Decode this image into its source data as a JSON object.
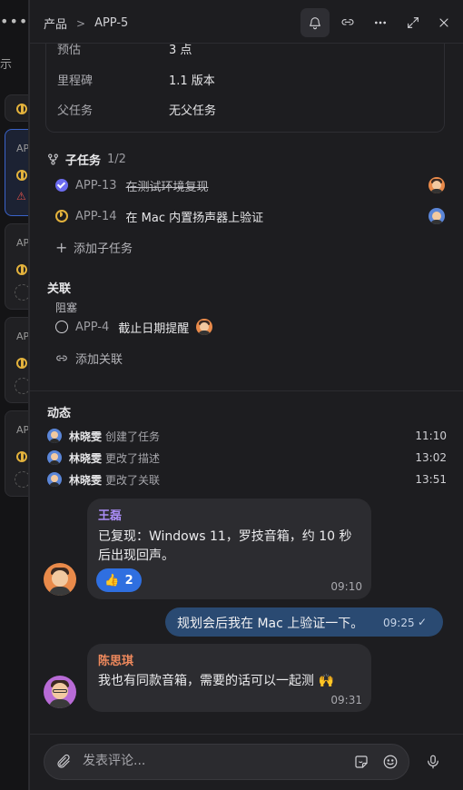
{
  "breadcrumb": {
    "project": "产品",
    "separator": ">",
    "issue": "APP-5"
  },
  "properties": {
    "rows": [
      {
        "label": "预估",
        "value": "3 点"
      },
      {
        "label": "里程碑",
        "value": "1.1 版本"
      },
      {
        "label": "父任务",
        "value": "无父任务"
      }
    ]
  },
  "subtasks": {
    "title": "子任务",
    "count": "1/2",
    "items": [
      {
        "key": "APP-13",
        "title": "在测试环境复现",
        "status": "done"
      },
      {
        "key": "APP-14",
        "title": "在 Mac 内置扬声器上验证",
        "status": "in-progress"
      }
    ],
    "add_label": "添加子任务"
  },
  "relations": {
    "title": "关联",
    "group_label": "阻塞",
    "items": [
      {
        "key": "APP-4",
        "title": "截止日期提醒",
        "status": "todo"
      }
    ],
    "add_label": "添加关联"
  },
  "activity": {
    "title": "动态",
    "items": [
      {
        "user": "林晓雯",
        "action": "创建了任务",
        "time": "11:10"
      },
      {
        "user": "林晓雯",
        "action": "更改了描述",
        "time": "13:02"
      },
      {
        "user": "林晓雯",
        "action": "更改了关联",
        "time": "13:51"
      }
    ]
  },
  "comments": [
    {
      "author": "王磊",
      "author_color": "#a98cf5",
      "lines": [
        "已复现：Windows 11，罗技音箱，约 10 秒",
        "后出现回声。"
      ],
      "reaction_emoji": "👍",
      "reaction_count": "2",
      "time": "09:10"
    },
    {
      "text": "规划会后我在 Mac 上验证一下。",
      "time": "09:25",
      "outgoing": true
    },
    {
      "author": "陈思琪",
      "author_color": "#f08a5d",
      "lines": [
        "我也有同款音箱，需要的话可以一起测 🙌"
      ],
      "time": "09:31"
    }
  ],
  "composer": {
    "placeholder": "发表评论..."
  },
  "background": {
    "label": "示",
    "card_key": "AP"
  },
  "colors": {
    "accent": "#2f6fe0",
    "in_progress": "#e3b23c",
    "done": "#6c6cf0",
    "outgoing_bubble": "#2a4a72"
  }
}
